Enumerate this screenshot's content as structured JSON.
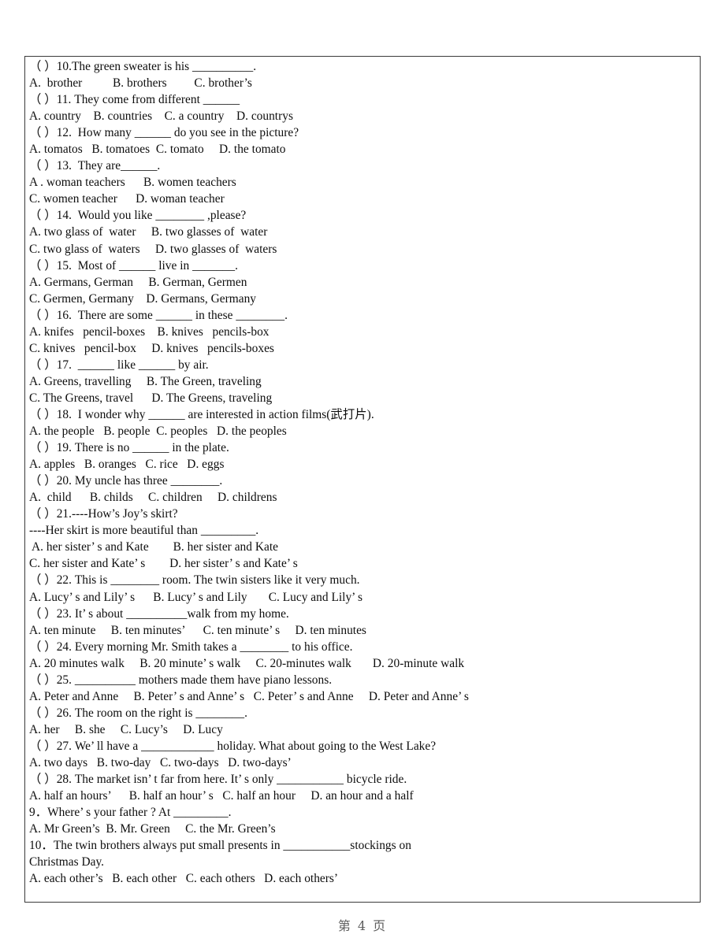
{
  "document": {
    "type": "english-grammar-worksheet",
    "page_label": "第 4 页",
    "page_number": 4
  },
  "lines": [
    "（ ）10.The green sweater is his __________.",
    "A.  brother          B. brothers         C. brother’s",
    "（ ）11. They come from different ______",
    "A. country    B. countries    C. a country    D. countrys",
    "（ ）12.  How many ______ do you see in the picture?",
    "A. tomatos   B. tomatoes  C. tomato     D. the tomato",
    "（ ）13.  They are______.",
    "A . woman teachers      B. women teachers",
    "C. women teacher      D. woman teacher",
    "（ ）14.  Would you like ________ ,please?",
    "A. two glass of  water     B. two glasses of  water",
    "C. two glass of  waters     D. two glasses of  waters",
    "（ ）15.  Most of ______ live in _______.",
    "A. Germans, German     B. German, Germen",
    "C. Germen, Germany    D. Germans, Germany",
    "（ ）16.  There are some ______ in these ________.",
    "A. knifes   pencil-boxes    B. knives   pencils-box",
    "C. knives   pencil-box     D. knives   pencils-boxes",
    "（ ）17.  ______ like ______ by air.",
    "A. Greens, travelling     B. The Green, traveling",
    "C. The Greens, travel      D. The Greens, traveling",
    "（ ）18.  I wonder why ______ are interested in action films(武打片).",
    "A. the people   B. people  C. peoples   D. the peoples",
    "（ ）19. There is no ______ in the plate.",
    "A. apples   B. oranges   C. rice   D. eggs",
    "（ ）20. My uncle has three ________.",
    "A.  child      B. childs     C. children     D. childrens",
    "（ ）21.----How’s Joy’s skirt?",
    "----Her skirt is more beautiful than _________.",
    " A. her sister’ s and Kate        B. her sister and Kate",
    "C. her sister and Kate’ s        D. her sister’ s and Kate’ s",
    "（ ）22. This is ________ room. The twin sisters like it very much.",
    "A. Lucy’ s and Lily’ s      B. Lucy’ s and Lily       C. Lucy and Lily’ s",
    "（ ）23. It’ s about __________walk from my home.",
    "A. ten minute     B. ten minutes’      C. ten minute’ s     D. ten minutes",
    "（ ）24. Every morning Mr. Smith takes a ________ to his office.",
    "A. 20 minutes walk     B. 20 minute’ s walk     C. 20-minutes walk       D. 20-minute walk",
    "（ ）25. __________ mothers made them have piano lessons.",
    "A. Peter and Anne     B. Peter’ s and Anne’ s   C. Peter’ s and Anne     D. Peter and Anne’ s",
    "（ ）26. The room on the right is ________.",
    "A. her     B. she     C. Lucy’s     D. Lucy",
    "（ ）27. We’ ll have a ____________ holiday. What about going to the West Lake?",
    "A. two days   B. two-day   C. two-days   D. two-days’",
    "（ ）28. The market isn’ t far from here. It’ s only ___________ bicycle ride.",
    "A. half an hours’      B. half an hour’ s   C. half an hour     D. an hour and a half",
    "9．Where’ s your father ? At _________.",
    "A. Mr Green’s  B. Mr. Green     C. the Mr. Green’s",
    "10．The twin brothers always put small presents in ___________stockings on",
    "Christmas Day.",
    "A. each other’s   B. each other   C. each others   D. each others’"
  ]
}
